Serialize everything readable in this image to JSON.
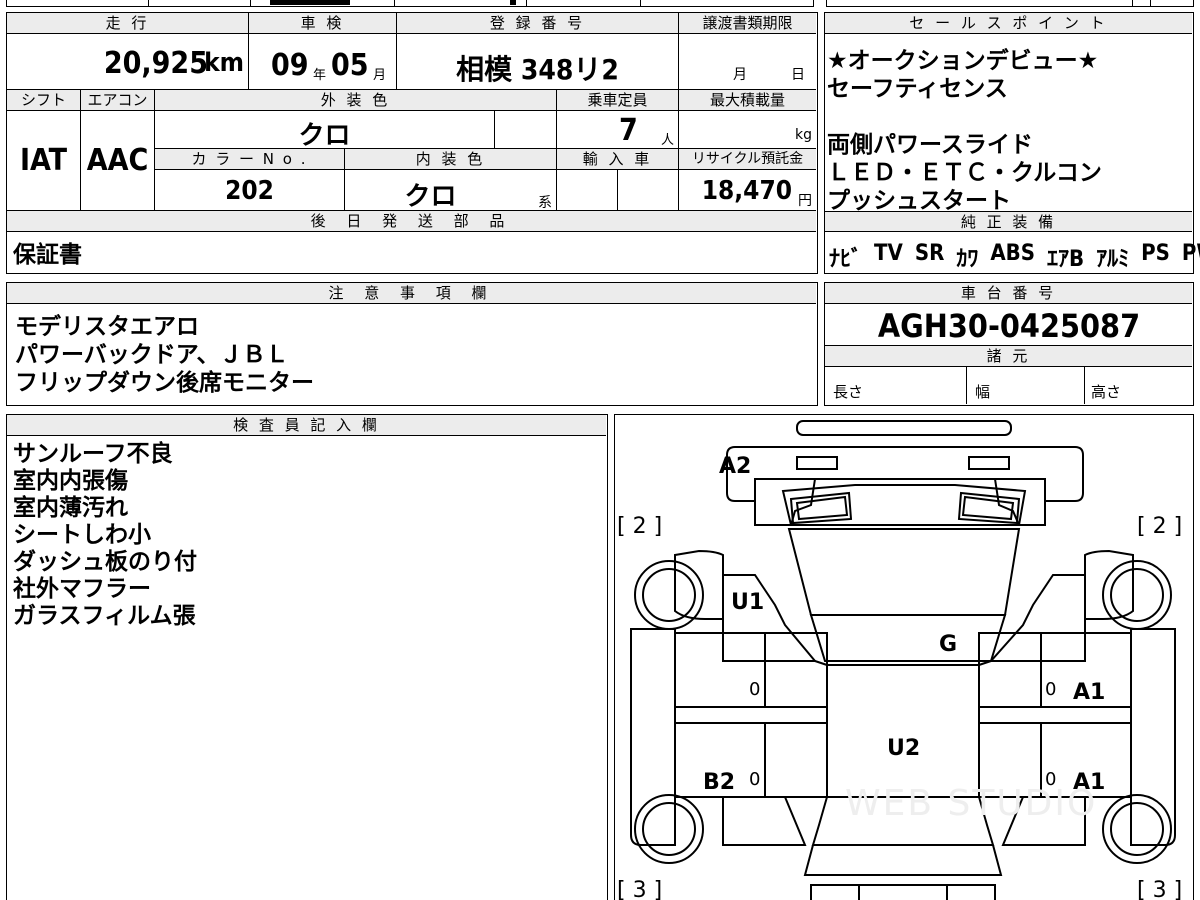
{
  "top_partial": [
    "",
    "",
    ""
  ],
  "info": {
    "mileage_header": "走 行",
    "mileage_value": "20,925",
    "mileage_unit": "km",
    "inspection_header": "車 検",
    "inspection_year": "09",
    "inspection_year_unit": "年",
    "inspection_month": "05",
    "inspection_month_unit": "月",
    "registration_header": "登 録 番 号",
    "registration_value": "相模 348リ2",
    "deadline_header": "譲渡書類期限",
    "deadline_month": "月",
    "deadline_day": "日",
    "shift_header": "シフト",
    "shift_value": "IAT",
    "aircon_header": "エアコン",
    "aircon_value": "AAC",
    "exterior_color_header": "外 装 色",
    "exterior_color_value": "クロ",
    "capacity_header": "乗車定員",
    "capacity_value": "7",
    "capacity_unit": "人",
    "load_header": "最大積載量",
    "load_unit": "kg",
    "color_no_header": "カ ラ ー N o .",
    "color_no_value": "202",
    "interior_color_header": "内 装 色",
    "interior_color_value": "クロ",
    "interior_color_suffix": "系",
    "import_header": "輸 入 車",
    "recycle_header": "リサイクル預託金",
    "recycle_value": "18,470",
    "recycle_unit": "円",
    "later_parts_header": "後 日 発 送 部 品",
    "later_parts_value": "保証書"
  },
  "sales_point": {
    "header": "セ ー ル ス ポ イ ン ト",
    "lines": [
      "★オークションデビュー★",
      "セーフティセンス",
      "",
      "両側パワースライド",
      "ＬＥＤ・ＥＴＣ・クルコン",
      "プッシュスタート"
    ]
  },
  "genuine_equipment": {
    "header": "純 正 装 備",
    "items": [
      "ﾅﾋﾞ",
      "TV",
      "SR",
      "ｶﾜ",
      "ABS",
      "ｴｱB",
      "ｱﾙﾐ",
      "PS",
      "PW"
    ]
  },
  "notes": {
    "header": "注 意 事 項 欄",
    "lines": [
      "モデリスタエアロ",
      "パワーバックドア、ＪＢＬ",
      "フリップダウン後席モニター"
    ]
  },
  "chassis": {
    "header": "車 台 番 号",
    "value": "AGH30-0425087"
  },
  "specs": {
    "header": "諸 元",
    "length_label": "長さ",
    "width_label": "幅",
    "height_label": "高さ"
  },
  "inspector": {
    "header": "検 査 員 記 入 欄",
    "lines": [
      "サンルーフ不良",
      "室内内張傷",
      "室内薄汚れ",
      "シートしわ小",
      "ダッシュ板のり付",
      "社外マフラー",
      "ガラスフィルム張"
    ]
  },
  "diagram": {
    "left_top_bracket": "[ 2 ]",
    "right_top_bracket": "[ 2 ]",
    "left_bottom_bracket": "[ 3 ]",
    "right_bottom_bracket": "[ 3 ]",
    "marks": {
      "a2": "A2",
      "u1": "U1",
      "g": "G",
      "a1_front": "A1",
      "a1_rear": "A1",
      "u2": "U2",
      "b2": "B2",
      "zero_1": "0",
      "zero_2": "0",
      "zero_3": "0",
      "zero_4": "0"
    },
    "watermark": "WEB STUDIO"
  }
}
